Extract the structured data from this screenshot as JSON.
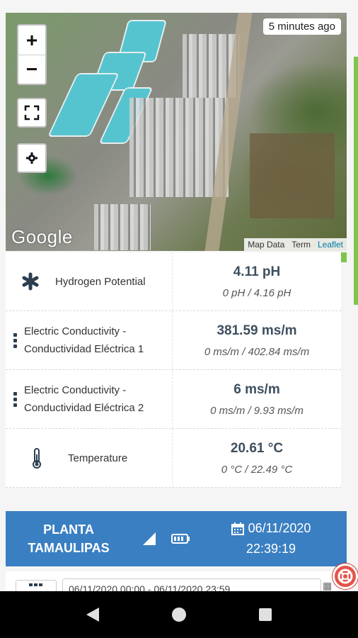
{
  "map": {
    "updated_badge": "5 minutes ago",
    "zoom_in": "+",
    "zoom_out": "−",
    "provider_logo": "Google",
    "attribution": {
      "map_data": "Map Data",
      "terms": "Term",
      "leaflet": "Leaflet"
    },
    "buttons": [
      "zoom-in",
      "zoom-out",
      "fullscreen-icon",
      "gear-icon"
    ]
  },
  "readings": [
    {
      "icon": "asterisk-icon",
      "label": "Hydrogen Potential",
      "value": "4.11 pH",
      "range": "0 pH / 4.16 pH"
    },
    {
      "icon": "vertical-dots-icon",
      "label": "Electric Conductivity - Conductividad Eléctrica 1",
      "value": "381.59 ms/m",
      "range": "0 ms/m / 402.84 ms/m"
    },
    {
      "icon": "vertical-dots-icon",
      "label": "Electric Conductivity - Conductividad Eléctrica 2",
      "value": "6 ms/m",
      "range": "0 ms/m / 9.93 ms/m"
    },
    {
      "icon": "thermometer-icon",
      "label": "Temperature",
      "value": "20.61 °C",
      "range": "0 °C / 22.49 °C"
    }
  ],
  "station": {
    "name_line1": "PLANTA",
    "name_line2": "TAMAULIPAS",
    "date": "06/11/2020",
    "time": "22:39:19",
    "signal_icon": "signal-icon",
    "battery_icon": "battery-icon",
    "calendar_icon": "calendar-icon"
  },
  "filter": {
    "range_value": "06/11/2020 00:00 - 06/11/2020 23:59"
  },
  "colors": {
    "accent_blue": "#3a7fc2",
    "accent_green": "#7ec54b",
    "value_text": "#3d4f5f",
    "help_red": "#e4534a"
  }
}
